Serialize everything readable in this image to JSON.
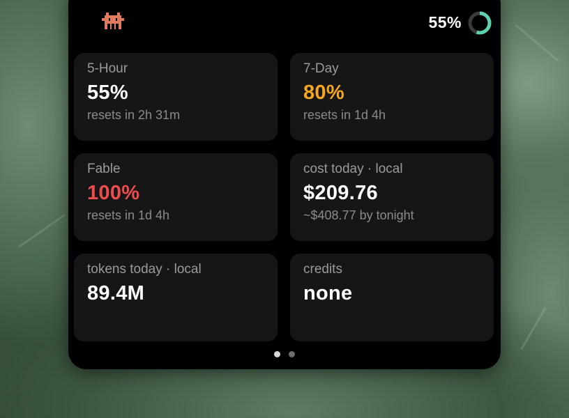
{
  "header": {
    "mascot_icon": "pixel-creature-icon",
    "mascot_color": "#e07a5f",
    "percent_label": "55%",
    "ring": {
      "fraction": 0.55,
      "color": "#5fd0b0",
      "track_color": "#3a3a3a"
    }
  },
  "cards": [
    {
      "label": "5-Hour",
      "value": "55%",
      "sub": "resets in 2h 31m",
      "value_color": "#ffffff"
    },
    {
      "label": "7-Day",
      "value": "80%",
      "sub": "resets in 1d 4h",
      "value_color": "#f5a623"
    },
    {
      "label": "Fable",
      "value": "100%",
      "sub": "resets in 1d 4h",
      "value_color": "#ee4d4d"
    },
    {
      "label": "cost today · local",
      "value": "$209.76",
      "sub": "~$408.77 by tonight",
      "value_color": "#ffffff"
    },
    {
      "label": "tokens today · local",
      "value": "89.4M",
      "sub": "",
      "value_color": "#ffffff"
    },
    {
      "label": "credits",
      "value": "none",
      "sub": "",
      "value_color": "#ffffff"
    }
  ],
  "pagination": {
    "current_page": 1,
    "total_pages": 2
  }
}
